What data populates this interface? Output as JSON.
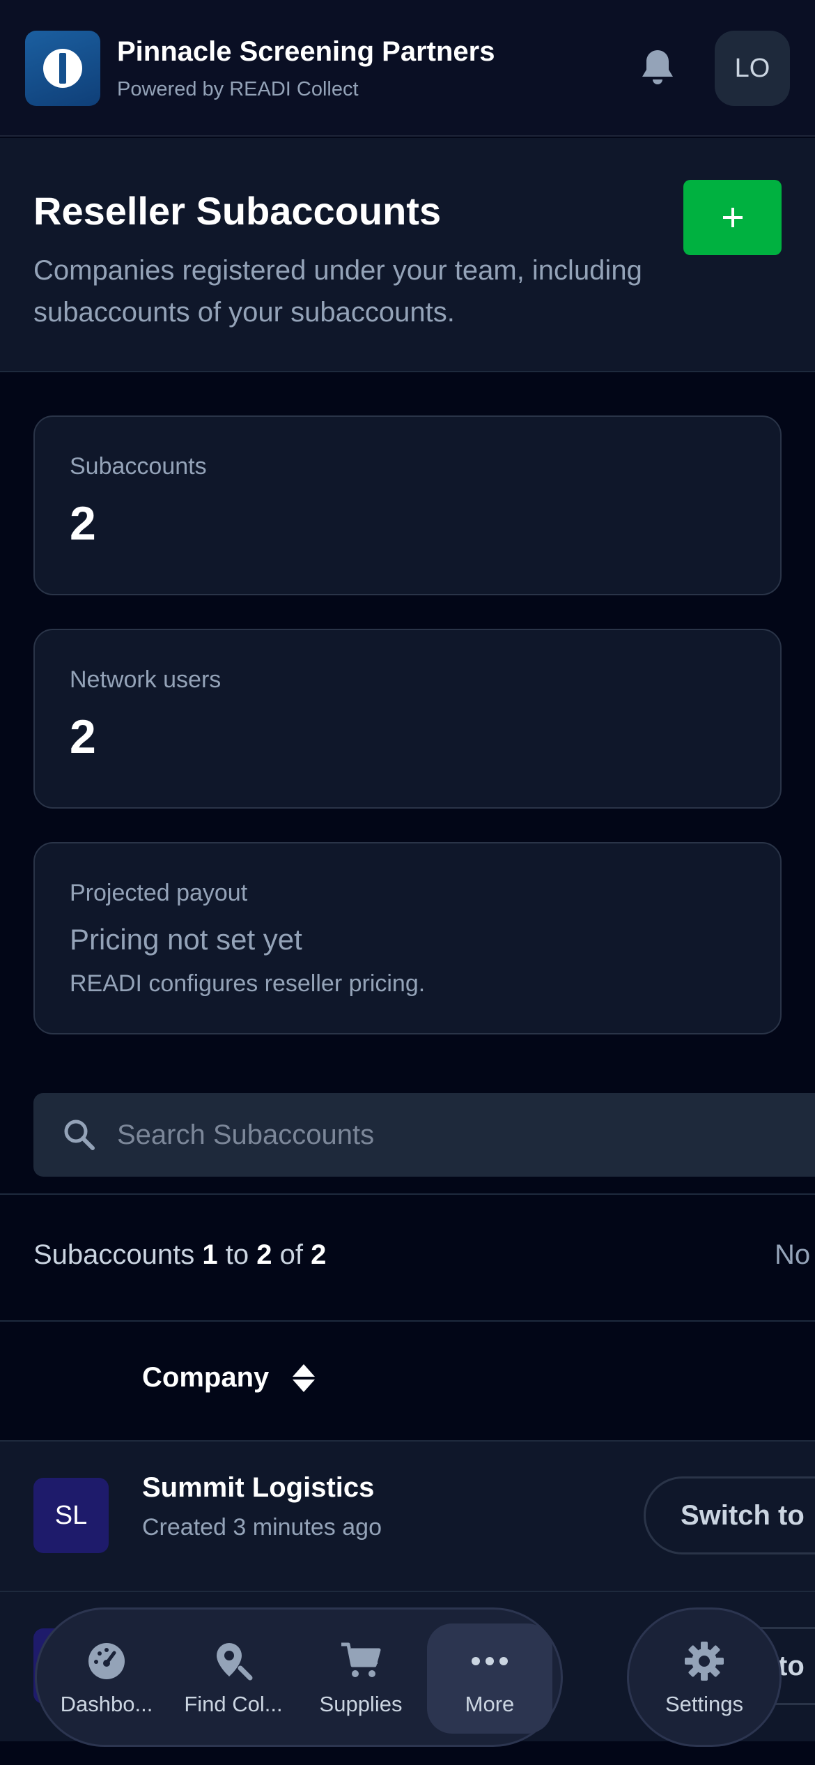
{
  "header": {
    "brand_name": "Pinnacle Screening Partners",
    "brand_sub": "Powered by READI Collect",
    "user_initials": "LO"
  },
  "page": {
    "title": "Reseller Subaccounts",
    "description": "Companies registered under your team, including subaccounts of your subaccounts.",
    "add_label": "+"
  },
  "stats": {
    "subaccounts": {
      "label": "Subaccounts",
      "value": "2"
    },
    "network_users": {
      "label": "Network users",
      "value": "2"
    },
    "projected_payout": {
      "label": "Projected payout",
      "text": "Pricing not set yet",
      "note": "READI configures reseller pricing."
    }
  },
  "search": {
    "placeholder": "Search Subaccounts"
  },
  "table": {
    "summary_prefix": "Subaccounts",
    "summary_from": "1",
    "summary_to_word": "to",
    "summary_to": "2",
    "summary_of_word": "of",
    "summary_total": "2",
    "summary_right": "No",
    "column_company": "Company",
    "rows": [
      {
        "initials": "SL",
        "name": "Summit Logistics",
        "created": "Created 3 minutes ago",
        "action": "Switch to"
      },
      {
        "initials": "",
        "name": "",
        "created": "",
        "action": "Switch to"
      }
    ]
  },
  "nav": {
    "items": [
      {
        "label": "Dashbo...",
        "icon": "dashboard-gauge-icon"
      },
      {
        "label": "Find Col...",
        "icon": "location-search-icon"
      },
      {
        "label": "Supplies",
        "icon": "cart-icon"
      },
      {
        "label": "More",
        "icon": "more-dots-icon"
      }
    ],
    "settings_label": "Settings",
    "active": "More"
  },
  "colors": {
    "background": "#020617",
    "surface": "#0f172a",
    "accent_green": "#00b140",
    "muted_text": "#94a3b8"
  }
}
